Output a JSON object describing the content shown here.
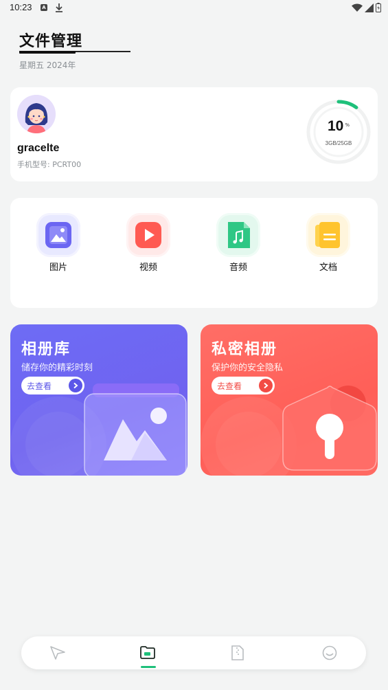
{
  "status_bar": {
    "time": "10:23"
  },
  "header": {
    "title": "文件管理",
    "date": "星期五  2024年"
  },
  "profile": {
    "username": "gracelte",
    "model_label": "手机型号: PCRT00",
    "usage_percent": 10,
    "usage_unit": "%",
    "storage": "3GB/25GB"
  },
  "categories": [
    {
      "label": "图片",
      "icon": "image-icon"
    },
    {
      "label": "视频",
      "icon": "play-icon"
    },
    {
      "label": "音频",
      "icon": "music-icon"
    },
    {
      "label": "文档",
      "icon": "document-icon"
    }
  ],
  "banners": [
    {
      "title": "相册库",
      "subtitle": "储存你的精彩时刻",
      "button": "去查看"
    },
    {
      "title": "私密相册",
      "subtitle": "保护你的安全隐私",
      "button": "去查看"
    }
  ],
  "tabbar": {
    "items": [
      {
        "icon": "send-icon",
        "active": false
      },
      {
        "icon": "folder-icon",
        "active": true
      },
      {
        "icon": "zip-file-icon",
        "active": false
      },
      {
        "icon": "smile-icon",
        "active": false
      }
    ]
  },
  "colors": {
    "accent_green": "#1ec07a",
    "album_purple": "#6e6cf5",
    "private_red": "#ff5f58"
  }
}
